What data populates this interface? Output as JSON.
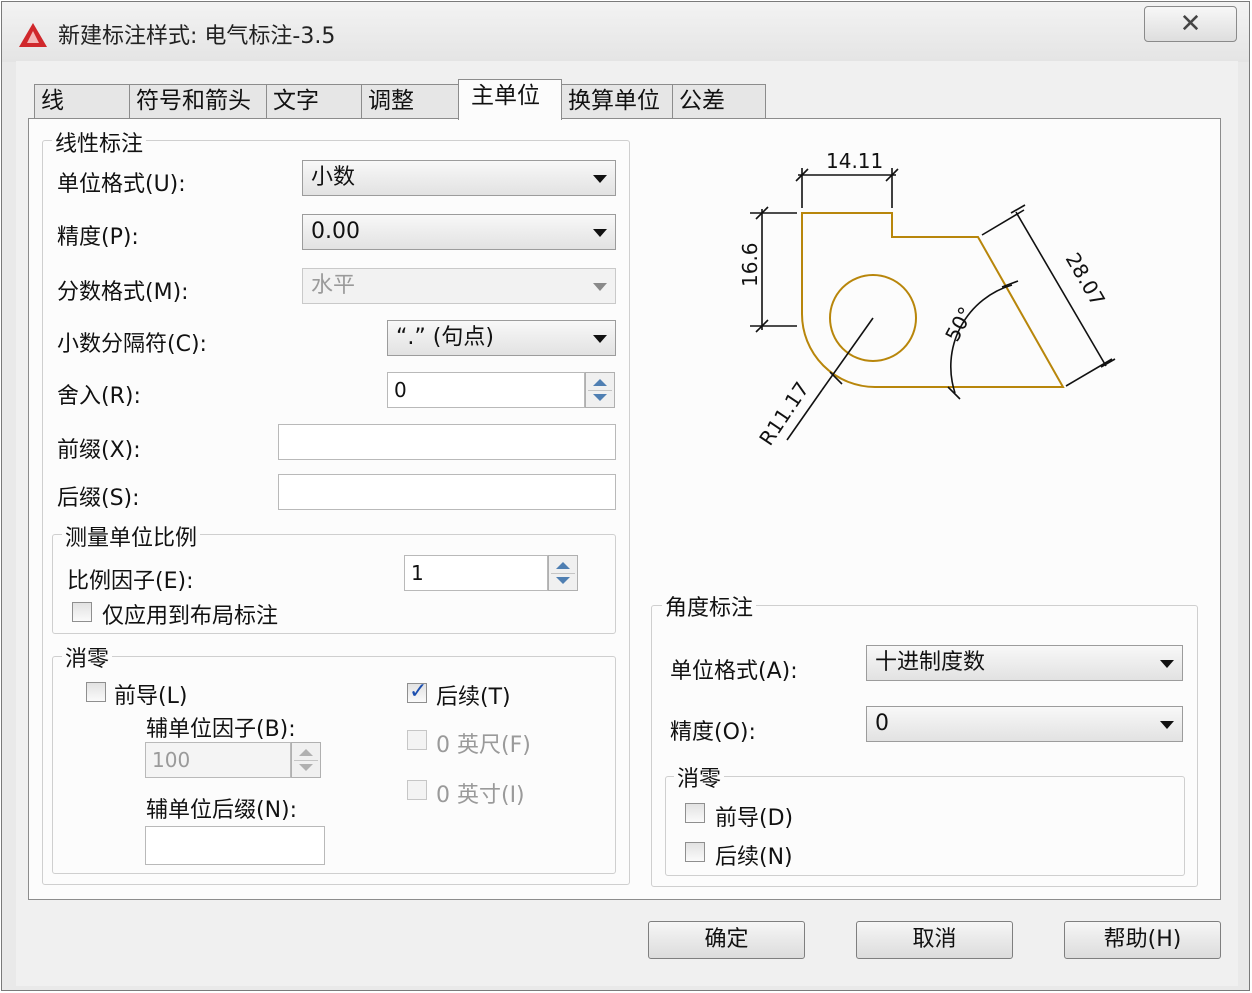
{
  "window": {
    "title": "新建标注样式: 电气标注-3.5",
    "close_symbol": "✕"
  },
  "tabs": [
    {
      "label": "线",
      "active": false
    },
    {
      "label": "符号和箭头",
      "active": false
    },
    {
      "label": "文字",
      "active": false
    },
    {
      "label": "调整",
      "active": false
    },
    {
      "label": "主单位",
      "active": true
    },
    {
      "label": "换算单位",
      "active": false
    },
    {
      "label": "公差",
      "active": false
    }
  ],
  "linear": {
    "group_title": "线性标注",
    "unit_format_label": "单位格式(U):",
    "unit_format_value": "小数",
    "precision_label": "精度(P):",
    "precision_value": "0.00",
    "fraction_format_label": "分数格式(M):",
    "fraction_format_value": "水平",
    "decimal_separator_label": "小数分隔符(C):",
    "decimal_separator_value": "“.” (句点)",
    "round_off_label": "舍入(R):",
    "round_off_value": "0",
    "prefix_label": "前缀(X):",
    "prefix_value": "",
    "suffix_label": "后缀(S):",
    "suffix_value": ""
  },
  "scale": {
    "group_title": "测量单位比例",
    "factor_label": "比例因子(E):",
    "factor_value": "1",
    "layout_only_label": "仅应用到布局标注",
    "layout_only_checked": false
  },
  "zero_suppression": {
    "group_title": "消零",
    "leading_label": "前导(L)",
    "leading_checked": false,
    "sub_unit_factor_label": "辅单位因子(B):",
    "sub_unit_factor_value": "100",
    "sub_unit_suffix_label": "辅单位后缀(N):",
    "sub_unit_suffix_value": "",
    "trailing_label": "后续(T)",
    "trailing_checked": true,
    "feet_label": "0 英尺(F)",
    "inches_label": "0 英寸(I)"
  },
  "angular": {
    "group_title": "角度标注",
    "unit_format_label": "单位格式(A):",
    "unit_format_value": "十进制度数",
    "precision_label": "精度(O):",
    "precision_value": "0",
    "zero_group_title": "消零",
    "leading_label": "前导(D)",
    "trailing_label": "后续(N)"
  },
  "preview": {
    "dim_top": "14.11",
    "dim_left": "16.6",
    "dim_slant": "28.07",
    "dim_angle": "50°",
    "dim_radius": "R11.17",
    "line_color": "#b8860b"
  },
  "buttons": {
    "ok": "确定",
    "cancel": "取消",
    "help": "帮助(H)"
  },
  "colors": {
    "app_icon": "#d0282c",
    "check": "#1c4fb0"
  }
}
